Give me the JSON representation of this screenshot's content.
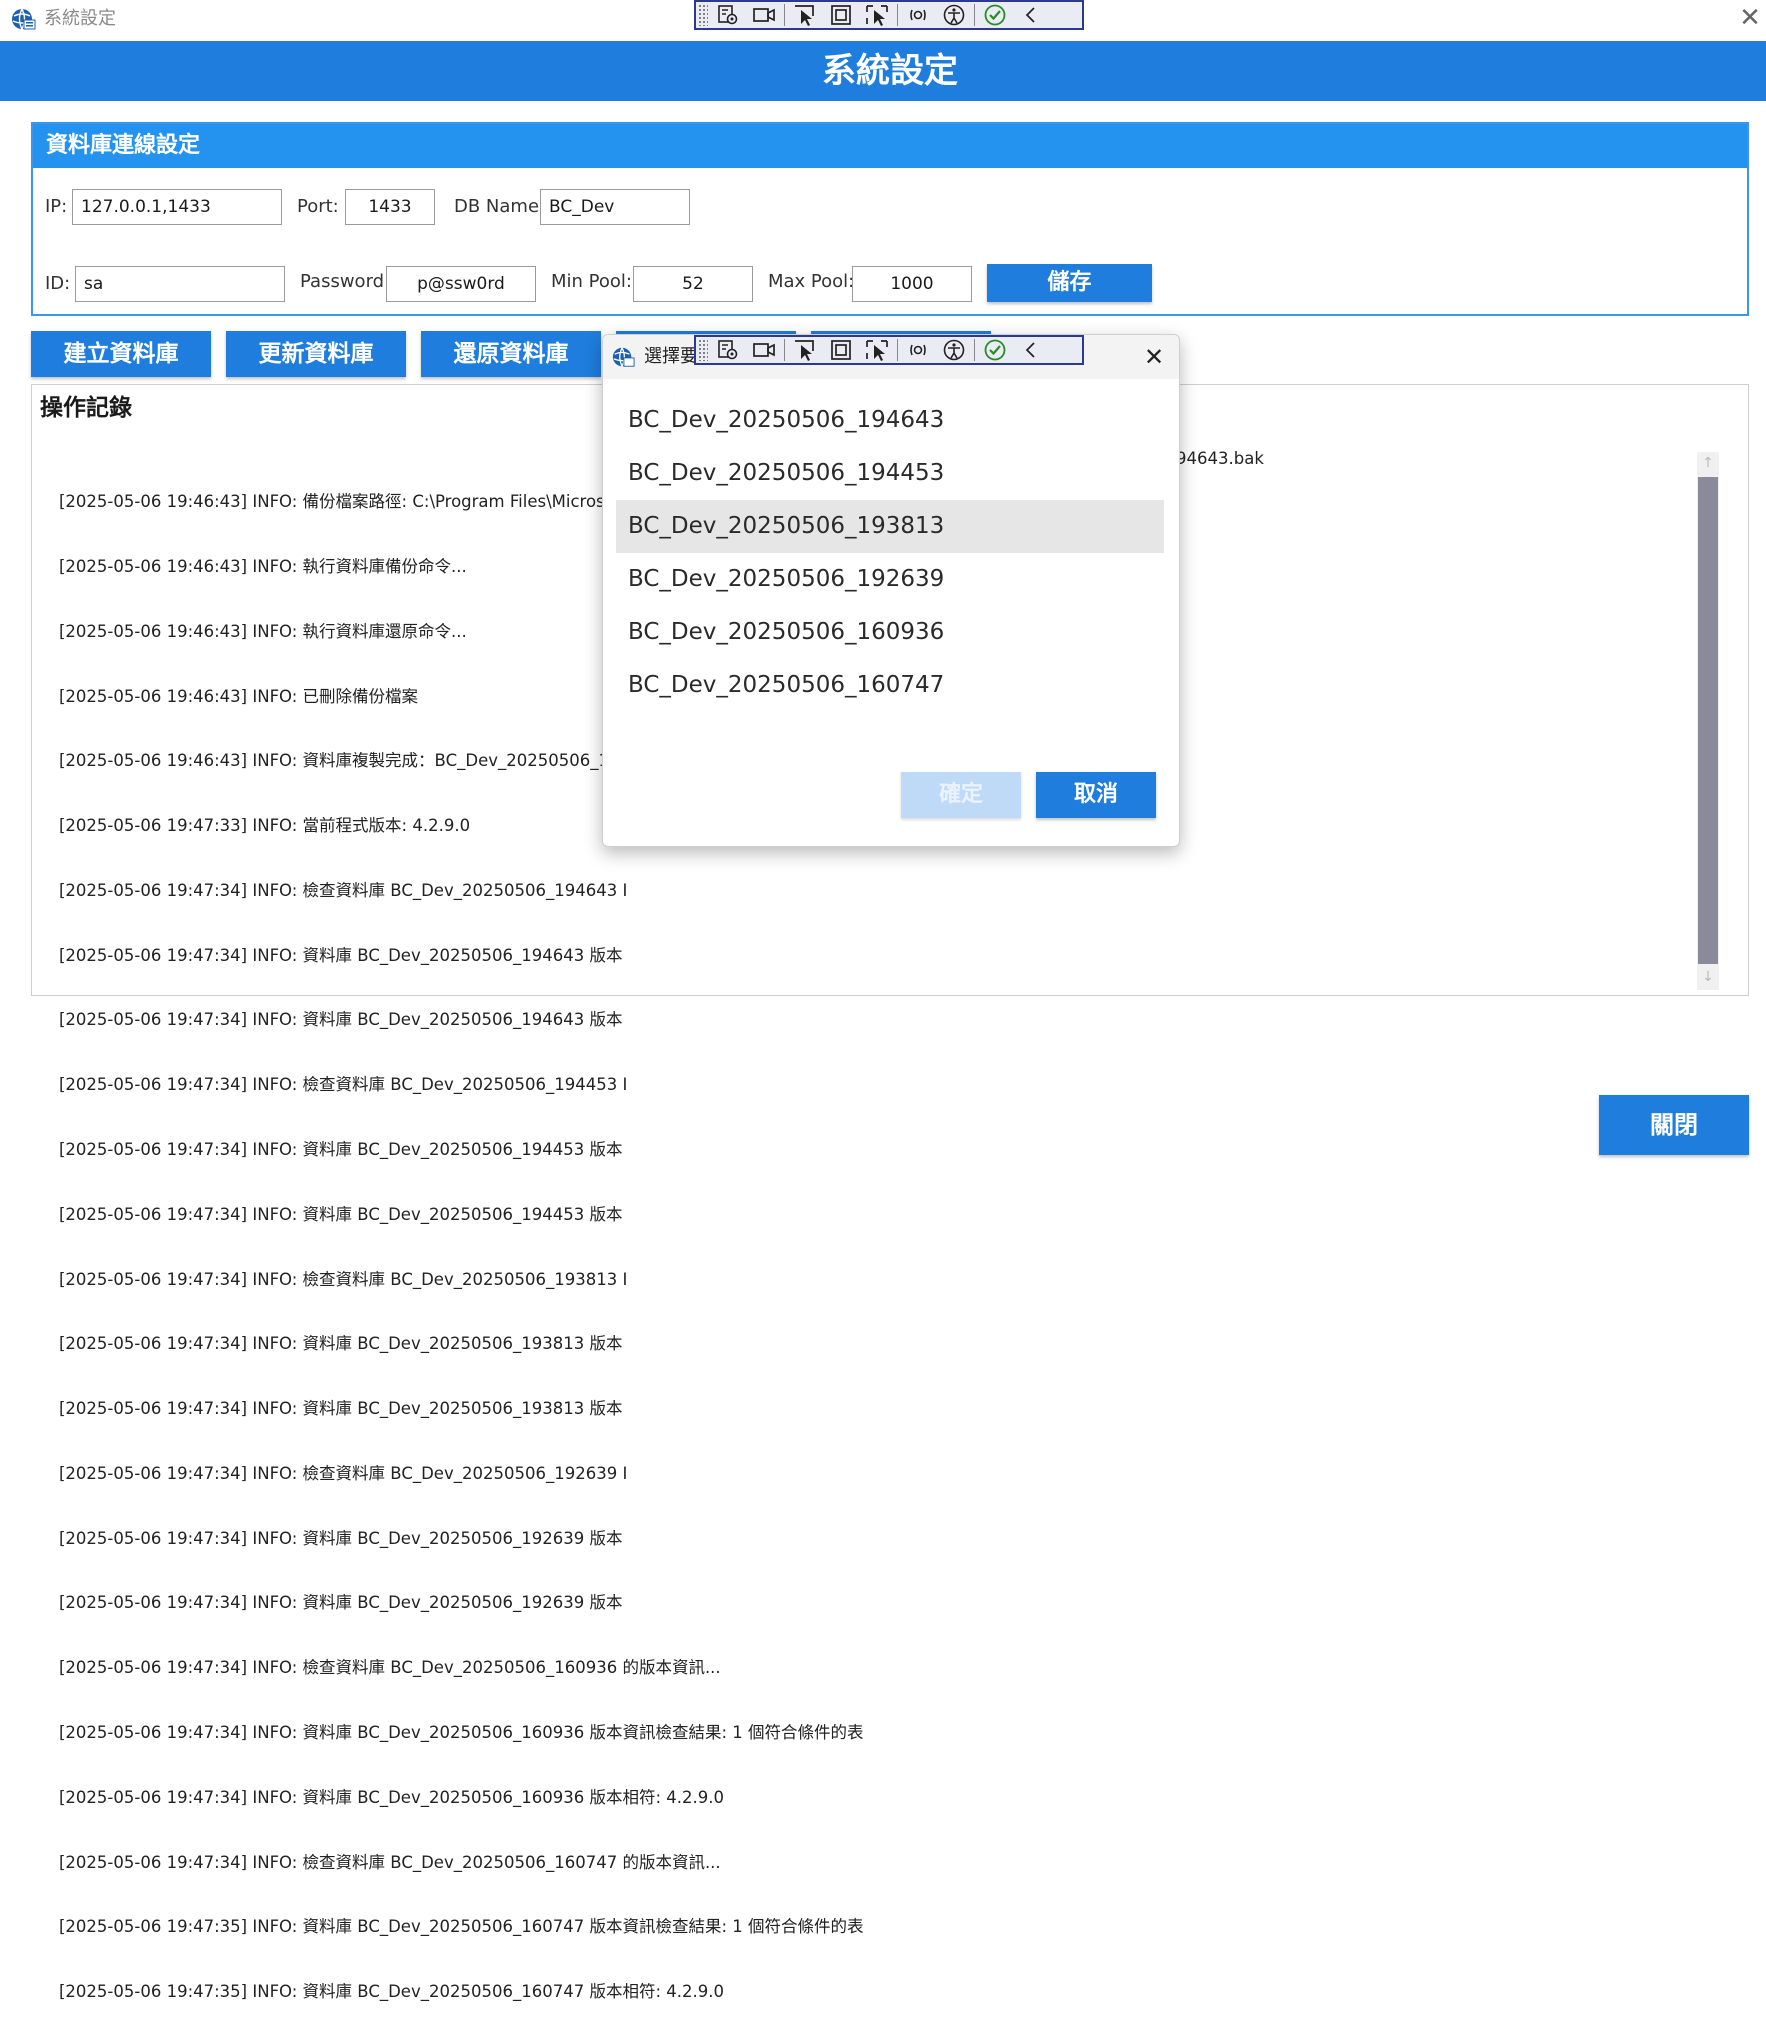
{
  "window": {
    "title": "系統設定",
    "close_glyph": "✕"
  },
  "header": {
    "title": "系統設定"
  },
  "db_settings": {
    "title": "資料庫連線設定",
    "ip_label": "IP:",
    "ip_value": "127.0.0.1,1433",
    "port_label": "Port:",
    "port_value": "1433",
    "dbname_label": "DB Name:",
    "dbname_value": "BC_Dev",
    "id_label": "ID:",
    "id_value": "sa",
    "password_label": "Password:",
    "password_value": "p@ssw0rd",
    "minpool_label": "Min Pool:",
    "minpool_value": "52",
    "maxpool_label": "Max Pool:",
    "maxpool_value": "1000",
    "save_label": "儲存"
  },
  "actions": {
    "create_db": "建立資料庫",
    "update_db": "更新資料庫",
    "restore_db": "還原資料庫"
  },
  "log": {
    "title": "操作記錄",
    "first_line_suffix": "94643.bak",
    "lines": [
      "[2025-05-06 19:46:43] INFO: 備份檔案路徑: C:\\Program Files\\Microsc",
      "[2025-05-06 19:46:43] INFO: 執行資料庫備份命令...",
      "[2025-05-06 19:46:43] INFO: 執行資料庫還原命令...",
      "[2025-05-06 19:46:43] INFO: 已刪除備份檔案",
      "[2025-05-06 19:46:43] INFO: 資料庫複製完成：BC_Dev_20250506_19",
      "[2025-05-06 19:47:33] INFO: 當前程式版本: 4.2.9.0",
      "[2025-05-06 19:47:34] INFO: 檢查資料庫 BC_Dev_20250506_194643 I",
      "[2025-05-06 19:47:34] INFO: 資料庫 BC_Dev_20250506_194643 版本",
      "[2025-05-06 19:47:34] INFO: 資料庫 BC_Dev_20250506_194643 版本",
      "[2025-05-06 19:47:34] INFO: 檢查資料庫 BC_Dev_20250506_194453 I",
      "[2025-05-06 19:47:34] INFO: 資料庫 BC_Dev_20250506_194453 版本",
      "[2025-05-06 19:47:34] INFO: 資料庫 BC_Dev_20250506_194453 版本",
      "[2025-05-06 19:47:34] INFO: 檢查資料庫 BC_Dev_20250506_193813 I",
      "[2025-05-06 19:47:34] INFO: 資料庫 BC_Dev_20250506_193813 版本",
      "[2025-05-06 19:47:34] INFO: 資料庫 BC_Dev_20250506_193813 版本",
      "[2025-05-06 19:47:34] INFO: 檢查資料庫 BC_Dev_20250506_192639 I",
      "[2025-05-06 19:47:34] INFO: 資料庫 BC_Dev_20250506_192639 版本",
      "[2025-05-06 19:47:34] INFO: 資料庫 BC_Dev_20250506_192639 版本",
      "[2025-05-06 19:47:34] INFO: 檢查資料庫 BC_Dev_20250506_160936 的版本資訊...",
      "[2025-05-06 19:47:34] INFO: 資料庫 BC_Dev_20250506_160936 版本資訊檢查結果: 1 個符合條件的表",
      "[2025-05-06 19:47:34] INFO: 資料庫 BC_Dev_20250506_160936 版本相符: 4.2.9.0",
      "[2025-05-06 19:47:34] INFO: 檢查資料庫 BC_Dev_20250506_160747 的版本資訊...",
      "[2025-05-06 19:47:35] INFO: 資料庫 BC_Dev_20250506_160747 版本資訊檢查結果: 1 個符合條件的表",
      "[2025-05-06 19:47:35] INFO: 資料庫 BC_Dev_20250506_160747 版本相符: 4.2.9.0"
    ],
    "scroll_up": "↑",
    "scroll_down": "↓"
  },
  "dialog": {
    "title": "選擇要",
    "close_glyph": "✕",
    "items": [
      "BC_Dev_20250506_194643",
      "BC_Dev_20250506_194453",
      "BC_Dev_20250506_193813",
      "BC_Dev_20250506_192639",
      "BC_Dev_20250506_160936",
      "BC_Dev_20250506_160747"
    ],
    "selected_index": 2,
    "confirm_label": "確定",
    "cancel_label": "取消"
  },
  "footer": {
    "close_label": "關閉"
  },
  "debug_toolbar": {
    "icons": [
      "live-visual-tree-icon",
      "record-icon",
      "select-element-icon",
      "display-layout-adorners-icon",
      "track-focus-icon",
      "hot-reload-icon",
      "accessibility-icon",
      "binding-check-icon",
      "collapse-chevron-icon"
    ]
  },
  "colors": {
    "accent": "#1f7ddd",
    "group_header": "#2493f0",
    "disabled_button": "#bfdaf7",
    "selected_item": "#e6e6e6",
    "scroll_thumb": "#8a8a9a"
  }
}
